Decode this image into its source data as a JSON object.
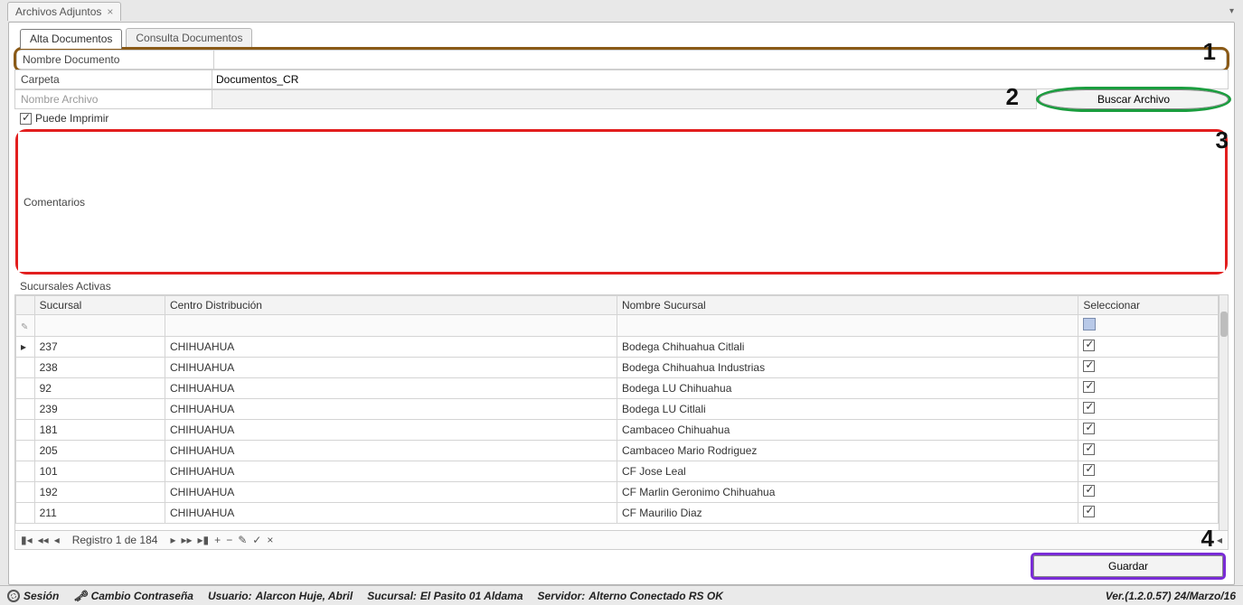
{
  "appTab": {
    "title": "Archivos Adjuntos"
  },
  "tabs": {
    "alta": "Alta Documentos",
    "consulta": "Consulta Documentos"
  },
  "labels": {
    "nombreDocumento": "Nombre Documento",
    "carpeta": "Carpeta",
    "nombreArchivo": "Nombre Archivo",
    "puedeImprimir": "Puede Imprimir",
    "comentarios": "Comentarios",
    "sucursalesActivas": "Sucursales Activas"
  },
  "values": {
    "carpeta": "Documentos_CR",
    "nombreDocumento": "",
    "nombreArchivo": "",
    "comentarios": "",
    "puedeImprimirChecked": true
  },
  "buttons": {
    "buscarArchivo": "Buscar Archivo",
    "guardar": "Guardar"
  },
  "annotations": {
    "n1": "1",
    "n2": "2",
    "n3": "3",
    "n4": "4"
  },
  "grid": {
    "headers": {
      "sucursal": "Sucursal",
      "centroDistribucion": "Centro Distribución",
      "nombreSucursal": "Nombre Sucursal",
      "seleccionar": "Seleccionar"
    },
    "nav": {
      "recordText": "Registro 1 de 184"
    },
    "rows": [
      {
        "sucursal": "237",
        "cd": "CHIHUAHUA",
        "nombre": "Bodega Chihuahua Citlali",
        "sel": true,
        "current": true
      },
      {
        "sucursal": "238",
        "cd": "CHIHUAHUA",
        "nombre": "Bodega Chihuahua Industrias",
        "sel": true
      },
      {
        "sucursal": "92",
        "cd": "CHIHUAHUA",
        "nombre": "Bodega LU Chihuahua",
        "sel": true
      },
      {
        "sucursal": "239",
        "cd": "CHIHUAHUA",
        "nombre": "Bodega LU Citlali",
        "sel": true
      },
      {
        "sucursal": "181",
        "cd": "CHIHUAHUA",
        "nombre": "Cambaceo Chihuahua",
        "sel": true
      },
      {
        "sucursal": "205",
        "cd": "CHIHUAHUA",
        "nombre": "Cambaceo Mario Rodriguez",
        "sel": true
      },
      {
        "sucursal": "101",
        "cd": "CHIHUAHUA",
        "nombre": "CF Jose Leal",
        "sel": true
      },
      {
        "sucursal": "192",
        "cd": "CHIHUAHUA",
        "nombre": "CF Marlin Geronimo Chihuahua",
        "sel": true
      },
      {
        "sucursal": "211",
        "cd": "CHIHUAHUA",
        "nombre": "CF Maurilio Diaz",
        "sel": true
      }
    ]
  },
  "status": {
    "sesion": "Sesión",
    "cambio": "Cambio Contraseña",
    "usuarioLabel": "Usuario:",
    "usuario": "Alarcon Huje, Abril",
    "sucursalLabel": "Sucursal:",
    "sucursal": "El Pasito 01 Aldama",
    "servidorLabel": "Servidor:",
    "servidor": "Alterno  Conectado RS OK",
    "version": "Ver.(1.2.0.57)  24/Marzo/16"
  }
}
